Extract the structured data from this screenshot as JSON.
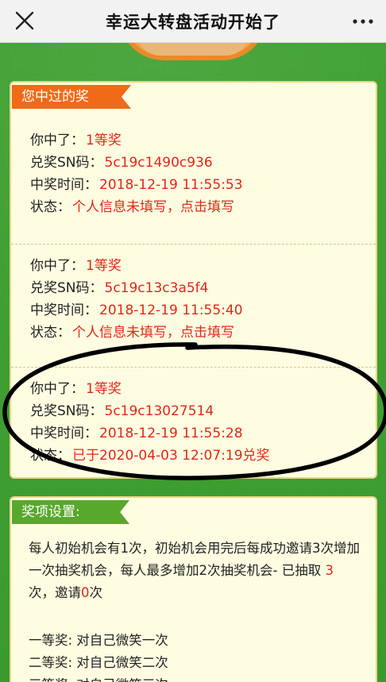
{
  "navbar": {
    "title": "幸运大转盘活动开始了",
    "close_icon": "close-icon",
    "more_icon": "more-dots-icon"
  },
  "wins_panel": {
    "header": "您中过的奖",
    "entries": [
      {
        "prize_label": "你中了：",
        "prize_value": "1等奖",
        "sn_label": "兑奖SN码：",
        "sn_value": "5c19c1490c936",
        "time_label": "中奖时间：",
        "time_value": "2018-12-19 11:55:53",
        "status_label": "状态：",
        "status_value": "个人信息未填写，点击填写"
      },
      {
        "prize_label": "你中了：",
        "prize_value": "1等奖",
        "sn_label": "兑奖SN码：",
        "sn_value": "5c19c13c3a5f4",
        "time_label": "中奖时间：",
        "time_value": "2018-12-19 11:55:40",
        "status_label": "状态：",
        "status_value": "个人信息未填写，点击填写"
      },
      {
        "prize_label": "你中了：",
        "prize_value": "1等奖",
        "sn_label": "兑奖SN码：",
        "sn_value": "5c19c13027514",
        "time_label": "中奖时间：",
        "time_value": "2018-12-19 11:55:28",
        "status_label": "状态：",
        "status_value": "已于2020-04-03 12:07:19兑奖"
      }
    ]
  },
  "rules_panel": {
    "header": "奖项设置:",
    "desc_part1": "每人初始机会有1次，初始机会用完后每成功邀请3次增加一次抽奖机会，每人最多增加2次抽奖机会- 已抽取 ",
    "drawn_count": "3",
    "desc_part2": " 次，邀请",
    "invite_count": "0",
    "desc_part3": "次",
    "prizes": [
      "一等奖: 对自己微笑一次",
      "二等奖: 对自己微笑二次",
      "三等奖: 对自己微笑三次"
    ]
  },
  "colors": {
    "accent_red": "#e0271a",
    "ribbon_orange": "#f06a18",
    "ribbon_green": "#58a82c",
    "panel_bg": "#fffde1",
    "page_green": "#3f9f32"
  }
}
